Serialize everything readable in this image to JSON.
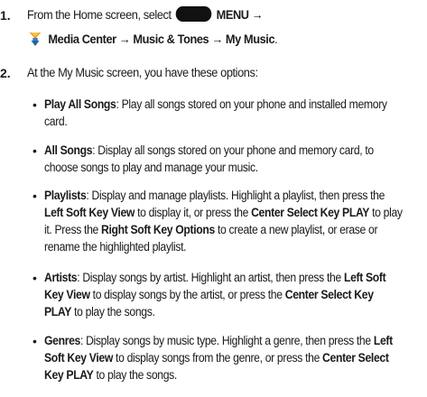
{
  "steps": [
    {
      "number": "1.",
      "line1_prefix": "From the Home screen, select",
      "menu_label": "MENU →",
      "line2": "Media Center → Music & Tones → My Music",
      "line2_suffix": "."
    },
    {
      "number": "2.",
      "text": "At the My Music screen, you have these options:"
    }
  ],
  "icons": {
    "menu_key": "menu-key-icon",
    "media_center": "media-center-icon"
  },
  "options": [
    {
      "term": "Play All Songs",
      "desc": ": Play all songs stored on your phone and installed memory card."
    },
    {
      "term": "All Songs",
      "desc": ": Display all songs stored on your phone and memory card, to choose songs to play and manage your music."
    },
    {
      "term": "Playlists",
      "parts": [
        ": Display and manage playlists. Highlight a playlist, then press the ",
        "Left Soft Key View",
        " to display it, or press the ",
        "Center Select Key PLAY",
        " to play it. Press the ",
        "Right Soft Key Options",
        " to create a new playlist, or erase or rename the highlighted playlist."
      ]
    },
    {
      "term": "Artists",
      "parts": [
        ": Display songs by artist. Highlight an artist, then press the ",
        "Left Soft Key View",
        " to display songs by the artist, or press the ",
        "Center Select Key PLAY",
        " to play the songs."
      ]
    },
    {
      "term": "Genres",
      "parts": [
        ": Display songs by music type. Highlight a genre, then press the ",
        "Left Soft Key View",
        " to display songs from the genre, or press the ",
        "Center Select Key PLAY",
        " to play the songs."
      ]
    }
  ]
}
